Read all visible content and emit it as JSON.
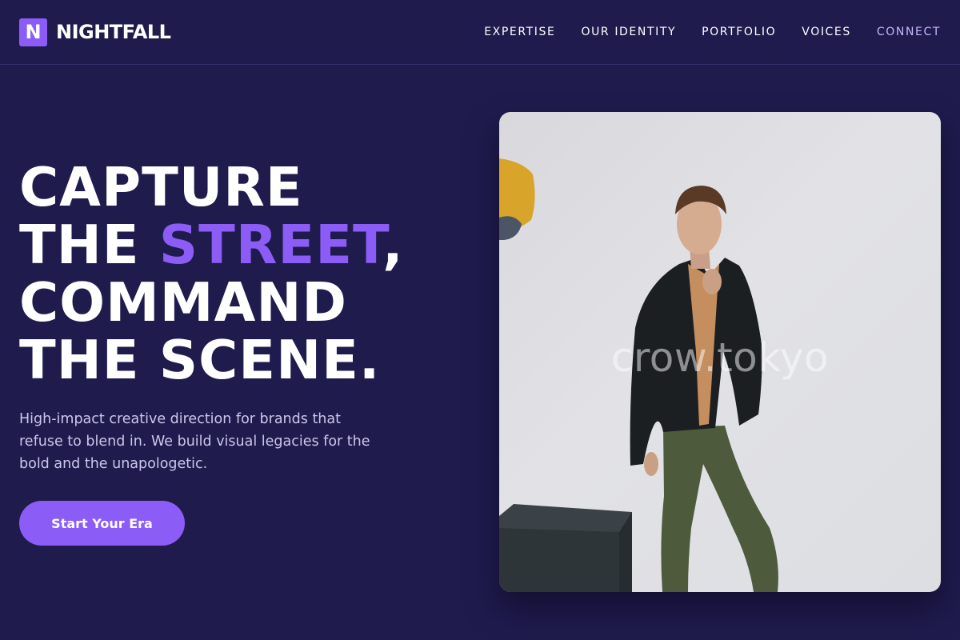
{
  "brand": {
    "logo_letter": "N",
    "name": "NIGHTFALL"
  },
  "nav": {
    "items": [
      {
        "label": "EXPERTISE"
      },
      {
        "label": "OUR IDENTITY"
      },
      {
        "label": "PORTFOLIO"
      },
      {
        "label": "VOICES"
      },
      {
        "label": "CONNECT"
      }
    ]
  },
  "hero": {
    "title_line1": "CAPTURE",
    "title_line2_pre": "THE ",
    "title_line2_highlight": "STREET",
    "title_line2_post": ",",
    "title_line3": "COMMAND",
    "title_line4": "THE SCENE.",
    "subtitle": "High-impact creative direction for brands that refuse to blend in. We build visual legacies for the bold and the unapologetic.",
    "cta_label": "Start Your Era",
    "image_watermark": "crow.tokyo"
  },
  "colors": {
    "background": "#1f1b4d",
    "accent": "#8b5cf6",
    "accent_light": "#c4b5fd",
    "subtitle_text": "#cbc7ea"
  }
}
